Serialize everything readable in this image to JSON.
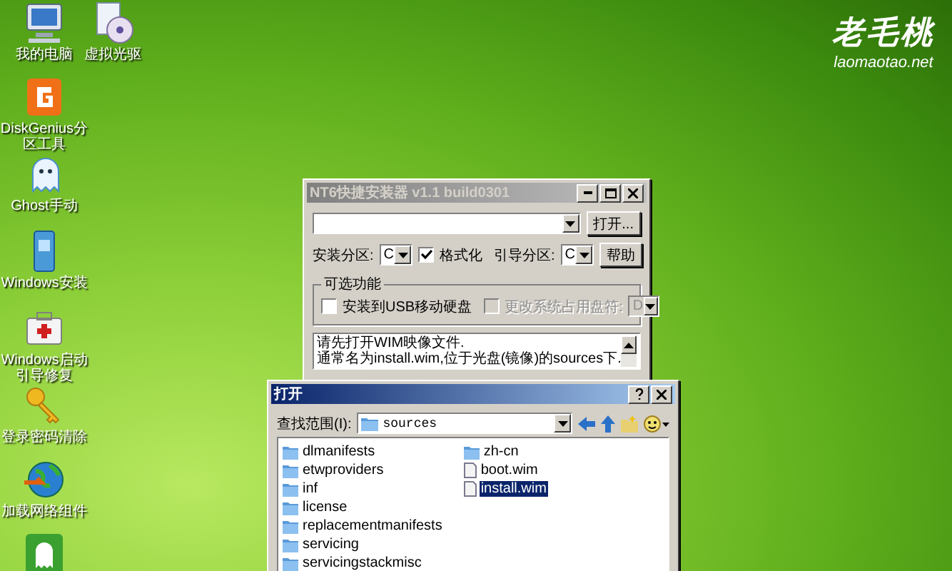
{
  "desktop_icons": [
    {
      "kind": "computer",
      "label": "我的电脑"
    },
    {
      "kind": "disc",
      "label": "虚拟光驱"
    },
    {
      "kind": "partition",
      "label": "DiskGenius分区工具"
    },
    {
      "kind": "ghost",
      "label": "Ghost手动"
    },
    {
      "kind": "installer",
      "label": "Windows安装"
    },
    {
      "kind": "toolbox",
      "label": "Windows启动引导修复"
    },
    {
      "kind": "key",
      "label": "登录密码清除"
    },
    {
      "kind": "globe",
      "label": "加载网络组件"
    },
    {
      "kind": "ghost-tile"
    }
  ],
  "logo": {
    "name": "老毛桃",
    "url": "laomaotao.net"
  },
  "installer": {
    "title": "NT6快捷安装器 v1.1 build0301",
    "open_button": "打开...",
    "install_partition": {
      "label": "安装分区:",
      "value": "C"
    },
    "format": {
      "label": "格式化",
      "checked": true
    },
    "boot_partition": {
      "label": "引导分区:",
      "value": "C"
    },
    "help_button": "帮助",
    "options_group": {
      "title": "可选功能",
      "usb": {
        "label": "安装到USB移动硬盘",
        "checked": false
      },
      "change_letter": {
        "label": "更改系统占用盘符:",
        "checked": false,
        "disabled": true,
        "value": "D"
      }
    },
    "message": [
      "请先打开WIM映像文件.",
      "通常名为install.wim,位于光盘(镜像)的sources下."
    ]
  },
  "open_dialog": {
    "title": "打开",
    "look_in_label": "查找范围(I):",
    "look_in_value": "sources",
    "files": [
      {
        "name": "dlmanifests",
        "kind": "folder",
        "selected": false
      },
      {
        "name": "etwproviders",
        "kind": "folder",
        "selected": false
      },
      {
        "name": "inf",
        "kind": "folder",
        "selected": false
      },
      {
        "name": "license",
        "kind": "folder",
        "selected": false
      },
      {
        "name": "replacementmanifests",
        "kind": "folder",
        "selected": false
      },
      {
        "name": "servicing",
        "kind": "folder",
        "selected": false
      },
      {
        "name": "servicingstackmisc",
        "kind": "folder",
        "selected": false
      },
      {
        "name": "zh-cn",
        "kind": "folder",
        "selected": false
      },
      {
        "name": "boot.wim",
        "kind": "file",
        "selected": false
      },
      {
        "name": "install.wim",
        "kind": "file",
        "selected": true
      }
    ]
  }
}
